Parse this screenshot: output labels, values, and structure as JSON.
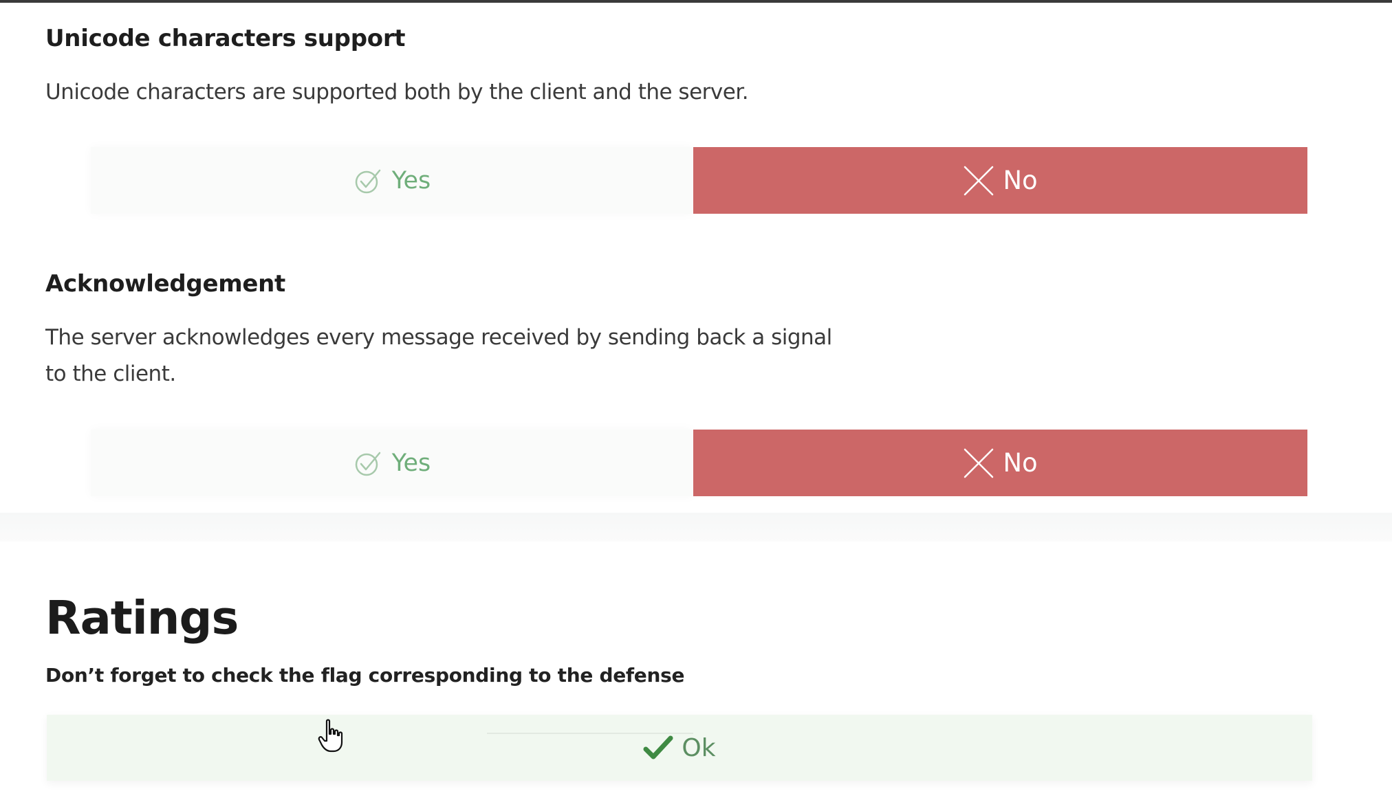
{
  "sections": [
    {
      "title": "Unicode characters support",
      "description": "Unicode characters are supported both by the client and the server.",
      "yes_label": "Yes",
      "no_label": "No",
      "selected": "No"
    },
    {
      "title": "Acknowledgement",
      "description_line1": "The server acknowledges every message received by sending back a signal",
      "description_line2": "to the client.",
      "yes_label": "Yes",
      "no_label": "No",
      "selected": "No"
    }
  ],
  "ratings": {
    "title": "Ratings",
    "note": "Don’t forget to check the flag corresponding to the defense",
    "ok_label": "Ok"
  },
  "icons": {
    "yes": "check-circle-icon",
    "no": "x-icon",
    "ok": "checkmark-icon",
    "cursor": "hand-pointer-cursor"
  },
  "colors": {
    "no_selected_bg": "#cc6767",
    "yes_text": "#6fae7a",
    "ok_bg": "#f1f8f0",
    "ok_check": "#3f8a43"
  }
}
